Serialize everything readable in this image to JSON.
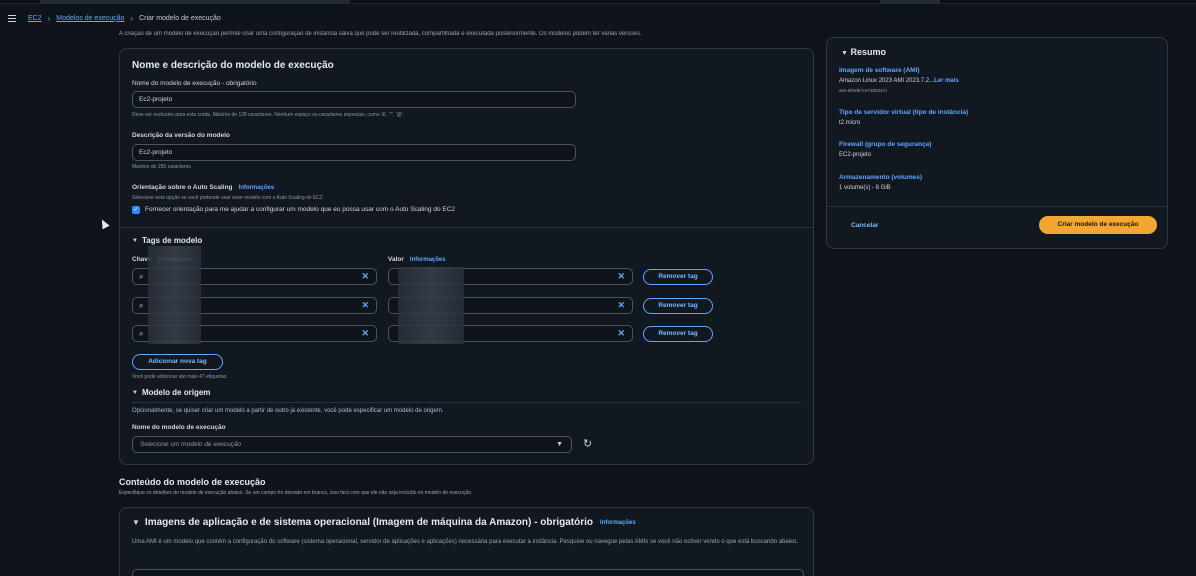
{
  "breadcrumb": {
    "items": [
      "EC2",
      "Modelos de execução",
      "Criar modelo de execução"
    ]
  },
  "intro": "A criação de um modelo de execução permite criar uma configuração de instância salva que pode ser reutilizada, compartilhada e executada posteriormente. Os modelos podem ter várias versões.",
  "main": {
    "title": "Nome e descrição do modelo de execução",
    "name_label": "Nome do modelo de execução - obrigatório",
    "name_value": "Ec2-projeto",
    "name_hint": "Deve ser exclusivo para esta conta. Máximo de 128 caracteres. Nenhum espaço ou caracteres especiais, como '&', '*', '@'.",
    "desc_label": "Descrição da versão do modelo",
    "desc_value": "Ec2-projeto",
    "desc_hint": "Máximo de 255 caracteres",
    "autoscaling_label": "Orientação sobre o Auto Scaling",
    "autoscaling_info": "Informações",
    "autoscaling_hint": "Selecione esta opção se você pretende usar esse modelo com o Auto Scaling do EC2",
    "autoscaling_checkbox_label": "Fornecer orientação para me ajudar a configurar um modelo que eu possa usar com o Auto Scaling do EC2",
    "tags": {
      "title": "Tags de modelo",
      "key_label": "Chave",
      "value_label": "Valor",
      "info": "Informações",
      "remove_label": "Remover tag",
      "rows": 3,
      "add_label": "Adicionar nova tag",
      "add_hint": "Você pode adicionar até mais 47 etiquetas."
    },
    "source": {
      "title": "Modelo de origem",
      "desc": "Opcionalmente, se quiser criar um modelo a partir de outro já existente, você pode especificar um modelo de origem.",
      "select_label": "Nome do modelo de execução",
      "select_placeholder": "Selecione um modelo de execução"
    }
  },
  "content": {
    "title": "Conteúdo do modelo de execução",
    "desc": "Especifique os detalhes do modelo de execução abaixo. Se um campo for deixado em branco, isso fará com que ele não seja incluído no modelo de execução."
  },
  "ami": {
    "title": "Imagens de aplicação e de sistema operacional (Imagem de máquina da Amazon) - obrigatório",
    "info": "Informações",
    "desc": "Uma AMI é um modelo que contém a configuração do software (sistema operacional, servidor de aplicações e aplicações) necessária para executar a instância. Pesquise ou navegue pelas AMIs se você não estiver vendo o que está buscando abaixo."
  },
  "summary": {
    "title": "Resumo",
    "ami_key": "Imagem de software (AMI)",
    "ami_value": "Amazon Linux 2023 AMI 2023.7.2...",
    "ami_more": "Ler mais",
    "ami_id": "ami-0fe6f67ce7360347c",
    "instance_key": "Tipo de servidor virtual (tipo de instância)",
    "instance_value": "t2.micro",
    "firewall_key": "Firewall (grupo de segurança)",
    "firewall_value": "EC2-projeto",
    "storage_key": "Armazenamento (volumes)",
    "storage_value": "1 volume(s) - 8 GiB",
    "cancel_label": "Cancelar",
    "create_label": "Criar modelo de execução"
  },
  "colors": {
    "accent": "#5ea6ff",
    "primary_button": "#f3a733",
    "background": "#0f141a"
  }
}
